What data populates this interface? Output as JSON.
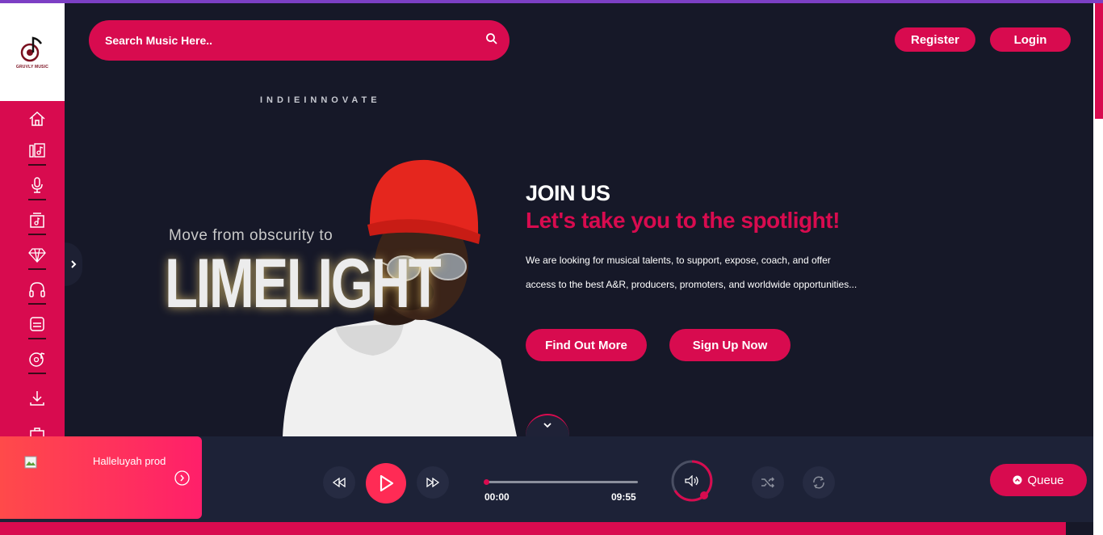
{
  "app": {
    "logo_text": "GRUVLY MUSIC"
  },
  "search": {
    "placeholder": "Search Music Here.."
  },
  "header": {
    "register_label": "Register",
    "login_label": "Login"
  },
  "hero": {
    "brand_tag": "INDIEINNOVATE",
    "art_line1": "Move from obscurity to",
    "art_line2": "LIMELIGHT",
    "heading": "JOIN US",
    "subheading": "Let's take you to the spotlight!",
    "desc_line1": "We are looking for musical talents, to support, expose, coach, and offer",
    "desc_line2": "access to the best A&R, producers, promoters, and worldwide opportunities...",
    "find_out_label": "Find Out More",
    "signup_label": "Sign Up Now"
  },
  "sidebar": {
    "items": [
      {
        "icon": "home-icon"
      },
      {
        "icon": "music-library-icon"
      },
      {
        "icon": "microphone-icon"
      },
      {
        "icon": "album-icon"
      },
      {
        "icon": "diamond-icon"
      },
      {
        "icon": "headphones-icon"
      },
      {
        "icon": "playlist-icon"
      },
      {
        "icon": "music-disc-icon"
      },
      {
        "icon": "download-icon"
      },
      {
        "icon": "shop-icon"
      }
    ]
  },
  "player": {
    "track_title": "Halleluyah prod",
    "current_time": "00:00",
    "duration": "09:55",
    "progress": 0,
    "queue_label": "Queue"
  },
  "colors": {
    "accent": "#d80b4f",
    "background": "#161828",
    "player_bg": "#1d2237"
  }
}
